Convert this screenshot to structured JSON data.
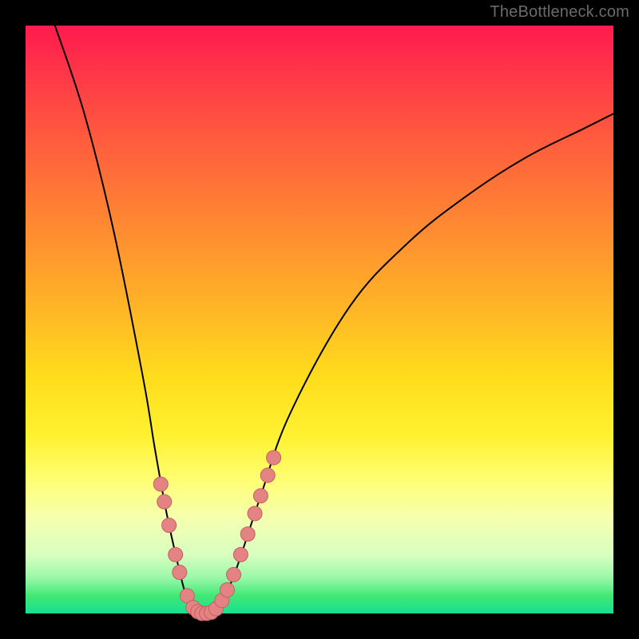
{
  "watermark": "TheBottleneck.com",
  "colors": {
    "background": "#000000",
    "curve": "#000000",
    "dot_fill": "#e38383",
    "dot_stroke": "#c65f5f",
    "gradient_top": "#ff1a4e",
    "gradient_bottom": "#18df90"
  },
  "chart_data": {
    "type": "line",
    "title": "",
    "xlabel": "",
    "ylabel": "",
    "xlim": [
      0,
      100
    ],
    "ylim": [
      0,
      100
    ],
    "grid": false,
    "series": [
      {
        "name": "bottleneck-curve",
        "x": [
          5,
          10,
          15,
          20,
          22,
          24,
          26,
          27,
          28,
          29,
          30,
          31,
          32,
          33,
          34,
          36,
          40,
          45,
          55,
          65,
          75,
          85,
          95,
          100
        ],
        "y": [
          100,
          85,
          65,
          40,
          28,
          17,
          8,
          4,
          1,
          0,
          0,
          0,
          0,
          1,
          3,
          8,
          20,
          34,
          52,
          63,
          71,
          77.5,
          82.5,
          85
        ]
      }
    ],
    "annotations": {
      "highlight_dots": [
        {
          "x": 23.0,
          "y": 22
        },
        {
          "x": 23.6,
          "y": 19
        },
        {
          "x": 24.4,
          "y": 15
        },
        {
          "x": 25.5,
          "y": 10
        },
        {
          "x": 26.2,
          "y": 7
        },
        {
          "x": 27.5,
          "y": 3
        },
        {
          "x": 28.5,
          "y": 1
        },
        {
          "x": 29.3,
          "y": 0.3
        },
        {
          "x": 30.0,
          "y": 0
        },
        {
          "x": 30.8,
          "y": 0
        },
        {
          "x": 31.6,
          "y": 0.2
        },
        {
          "x": 32.4,
          "y": 0.8
        },
        {
          "x": 33.4,
          "y": 2.2
        },
        {
          "x": 34.3,
          "y": 4.0
        },
        {
          "x": 35.4,
          "y": 6.6
        },
        {
          "x": 36.6,
          "y": 10
        },
        {
          "x": 37.8,
          "y": 13.5
        },
        {
          "x": 39.0,
          "y": 17
        },
        {
          "x": 40.0,
          "y": 20
        },
        {
          "x": 41.2,
          "y": 23.5
        },
        {
          "x": 42.2,
          "y": 26.5
        }
      ]
    }
  }
}
